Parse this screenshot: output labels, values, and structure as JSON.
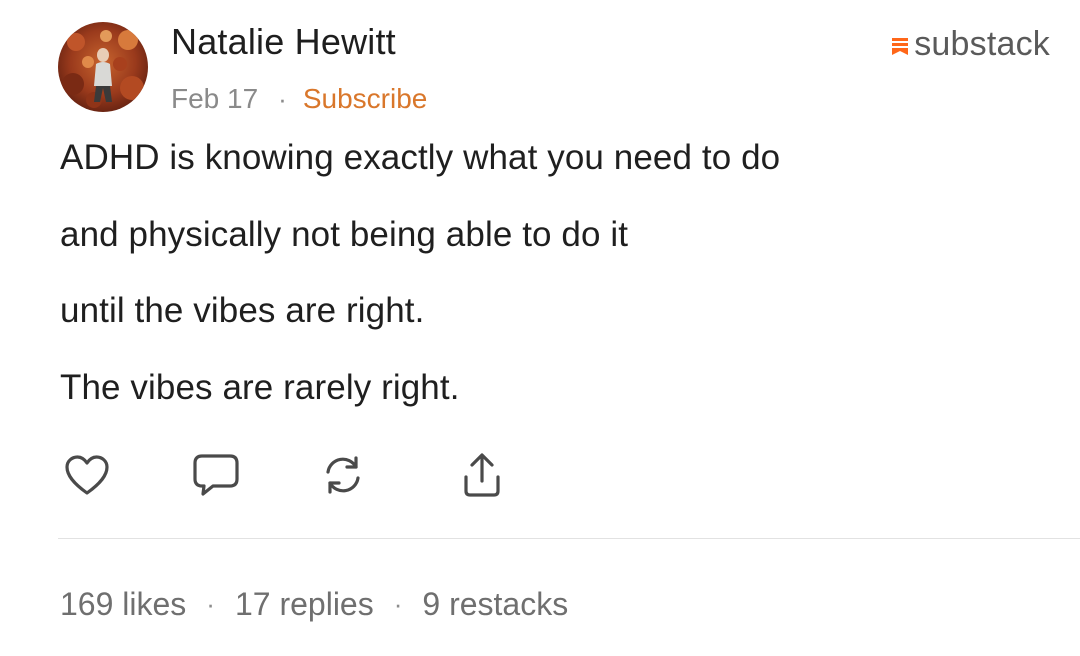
{
  "author": {
    "name": "Natalie Hewitt",
    "avatar": "profile-photo"
  },
  "meta": {
    "date": "Feb 17",
    "separator": "·",
    "subscribe_label": "Subscribe"
  },
  "brand": {
    "name": "substack",
    "icon": "substack-logo-icon",
    "accent_color": "#ff6719"
  },
  "post": {
    "lines": [
      "ADHD is knowing exactly what you need to do",
      "and physically not being able to do it",
      "until the vibes are right.",
      "The vibes are rarely right."
    ]
  },
  "actions": {
    "like_icon": "heart-icon",
    "reply_icon": "comment-icon",
    "restack_icon": "restack-icon",
    "share_icon": "share-icon"
  },
  "stats": {
    "likes": "169 likes",
    "replies": "17 replies",
    "restacks": "9 restacks",
    "separator": "·"
  },
  "colors": {
    "subscribe": "#d9772b",
    "muted_text": "#8a8a8a",
    "body_text": "#1f1f1f"
  }
}
